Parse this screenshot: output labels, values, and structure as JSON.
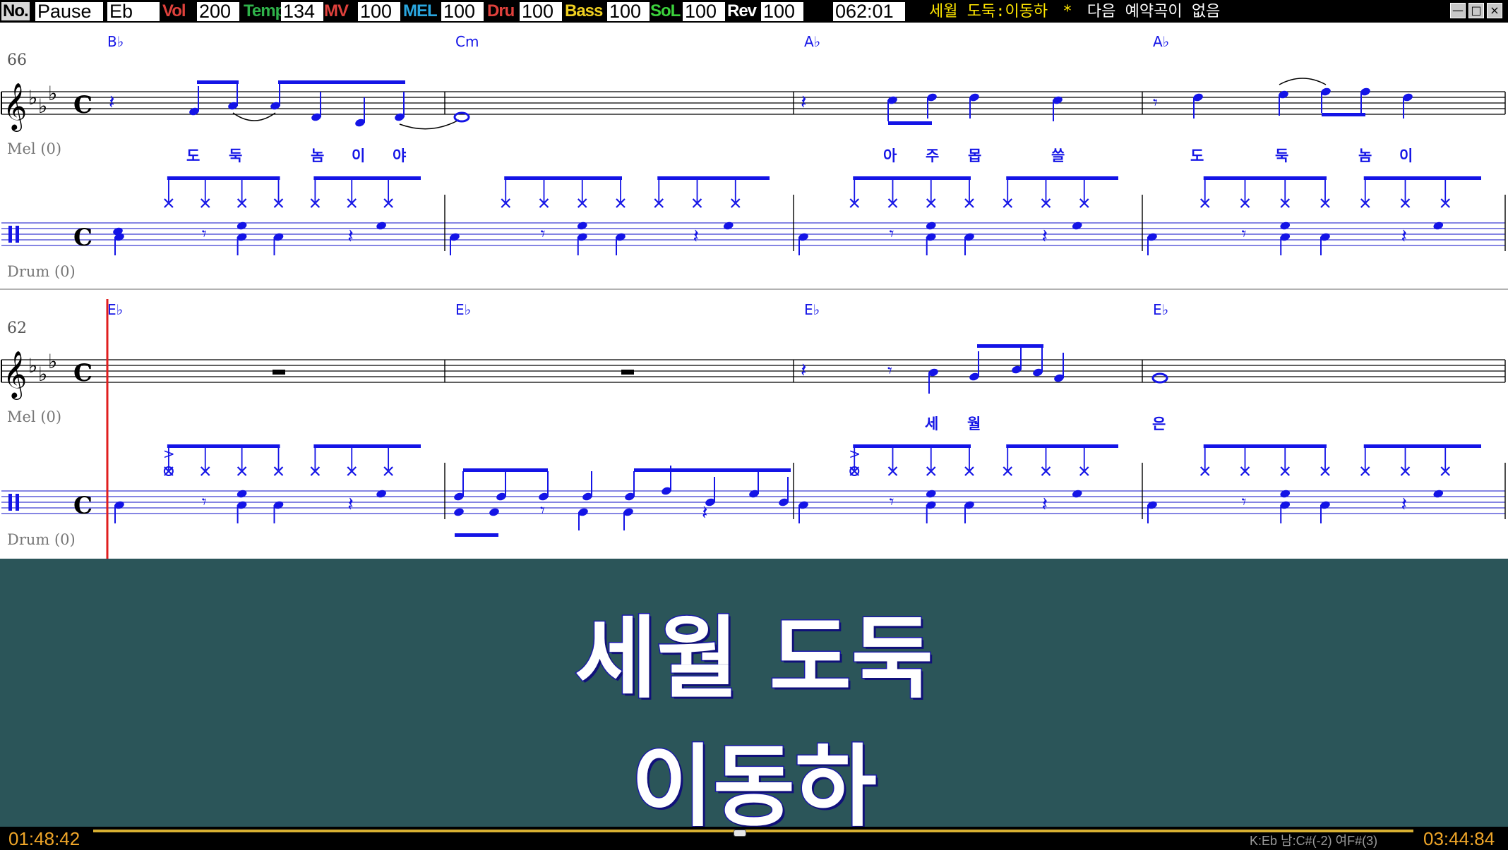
{
  "topbar": {
    "no_label": "No.",
    "status": "Pause",
    "key": "Eb",
    "controls": [
      {
        "label": "Vol",
        "value": "200",
        "color": "#e0413c"
      },
      {
        "label": "Temp",
        "value": "134",
        "color": "#2fb24a"
      },
      {
        "label": "MV",
        "value": "100",
        "color": "#e0413c"
      },
      {
        "label": "MEL",
        "value": "100",
        "color": "#2aa7e0"
      },
      {
        "label": "Dru",
        "value": "100",
        "color": "#e0413c"
      },
      {
        "label": "Bass",
        "value": "100",
        "color": "#f0d020"
      },
      {
        "label": "SoL",
        "value": "100",
        "color": "#3cd23c"
      },
      {
        "label": "Rev",
        "value": "100",
        "color": "#ffffff"
      }
    ],
    "counter": "062:01",
    "song_title": "세월 도둑:이동하",
    "separator": "*",
    "next_song": "다음 예약곡이 없음",
    "window_buttons": [
      "minimize-icon",
      "maximize-icon",
      "close-icon"
    ]
  },
  "score": {
    "system1": {
      "measure_number": "66",
      "chords": [
        "B♭",
        "Cm",
        "A♭",
        "A♭"
      ],
      "mel_label": "Mel (0)",
      "drum_label": "Drum (0)",
      "lyrics": [
        "도",
        "둑",
        "놈",
        "이",
        "야",
        "아",
        "주",
        "몹",
        "쓸",
        "도",
        "둑",
        "놈",
        "이"
      ]
    },
    "system2": {
      "measure_number": "62",
      "chords": [
        "E♭",
        "E♭",
        "E♭",
        "E♭"
      ],
      "mel_label": "Mel (0)",
      "drum_label": "Drum (0)",
      "lyrics": [
        "세",
        "월",
        "은"
      ]
    },
    "time_signature": "C",
    "colors": {
      "notes": "#1414e6",
      "chords": "#1414e6",
      "staff": "#3c3cd2",
      "cursor": "#e01e1e"
    }
  },
  "lyrics_panel": {
    "line1": "세월 도둑",
    "line2": "이동하",
    "background": "#2b5559"
  },
  "bottombar": {
    "elapsed": "01:48:42",
    "total": "03:44:84",
    "progress": 0.49,
    "key_info": "K:Eb 남:C#(-2) 여F#(3)"
  }
}
